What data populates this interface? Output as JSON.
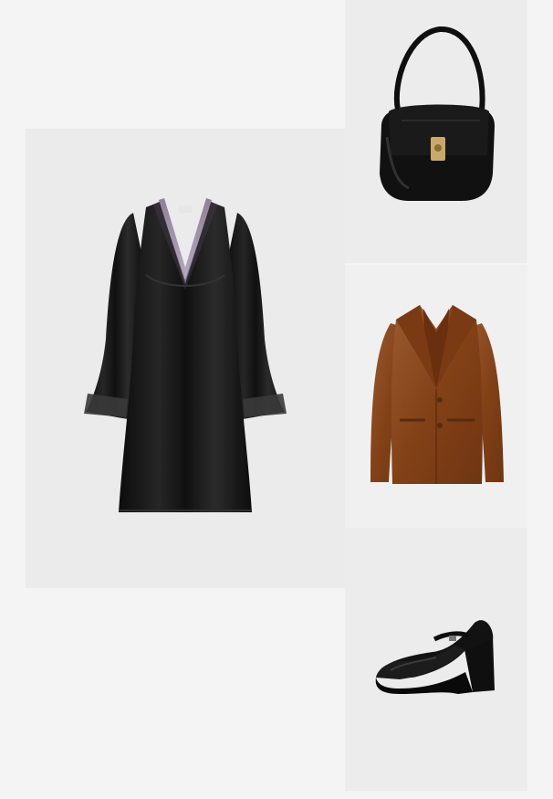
{
  "outfit": {
    "items": [
      {
        "id": "dress",
        "icon": "black-satin-lace-dress-image"
      },
      {
        "id": "bag",
        "icon": "black-leather-shoulder-bag-image"
      },
      {
        "id": "jacket",
        "icon": "brown-suede-blazer-image"
      },
      {
        "id": "shoes",
        "icon": "black-mary-jane-heel-image"
      }
    ]
  },
  "colors": {
    "page_background": "#f4f4f4",
    "tile_background": "#ebebeb",
    "satin_black": "#161616",
    "lace_lilac": "#a99ab3",
    "suede_brown": "#8e4a24",
    "gold_hardware": "#c9a96a"
  }
}
